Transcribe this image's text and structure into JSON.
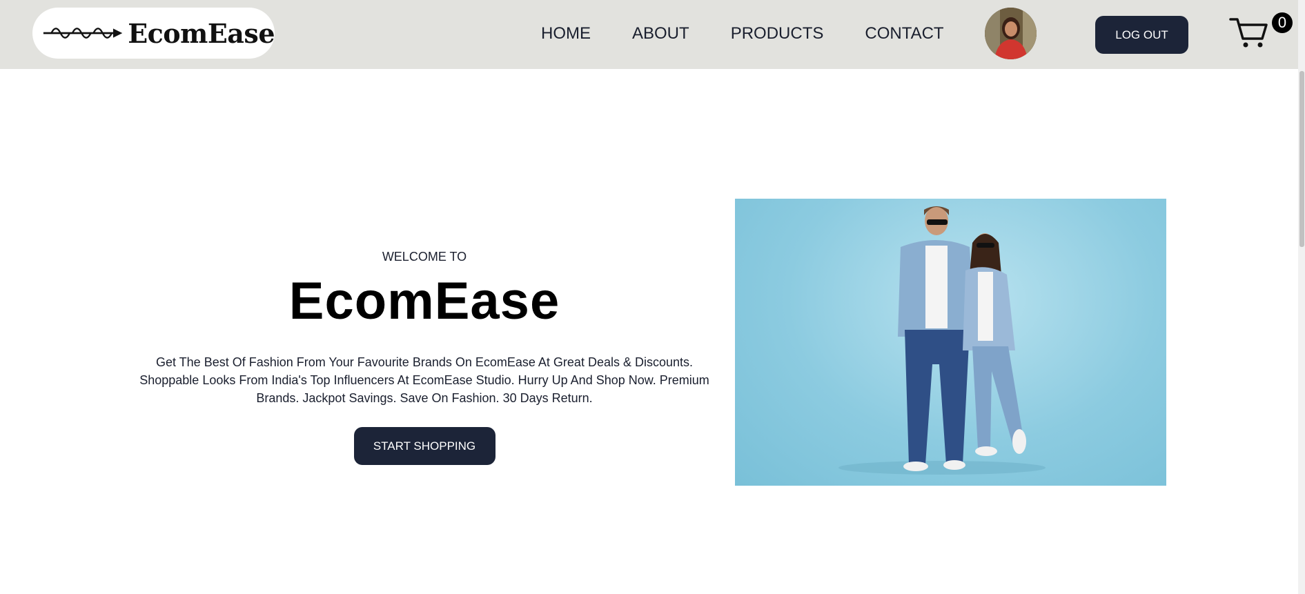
{
  "header": {
    "logo_text": "EcomEase",
    "nav": [
      {
        "label": "HOME"
      },
      {
        "label": "ABOUT"
      },
      {
        "label": "PRODUCTS"
      },
      {
        "label": "CONTACT"
      }
    ],
    "logout_label": "LOG OUT",
    "cart_count": "0",
    "icons": {
      "cart": "cart-icon",
      "logo_wave": "wave-arrow-icon"
    }
  },
  "hero": {
    "welcome": "WELCOME TO",
    "brand": "EcomEase",
    "description": "Get The Best Of Fashion From Your Favourite Brands On EcomEase At Great Deals & Discounts. Shoppable Looks From India's Top Influencers At EcomEase Studio. Hurry Up And Shop Now. Premium Brands. Jackpot Savings. Save On Fashion. 30 Days Return.",
    "cta_label": "START SHOPPING"
  },
  "colors": {
    "header_bg": "#e2e2de",
    "button_bg": "#1c2438",
    "hero_image_bg": "#8ccbe0"
  }
}
